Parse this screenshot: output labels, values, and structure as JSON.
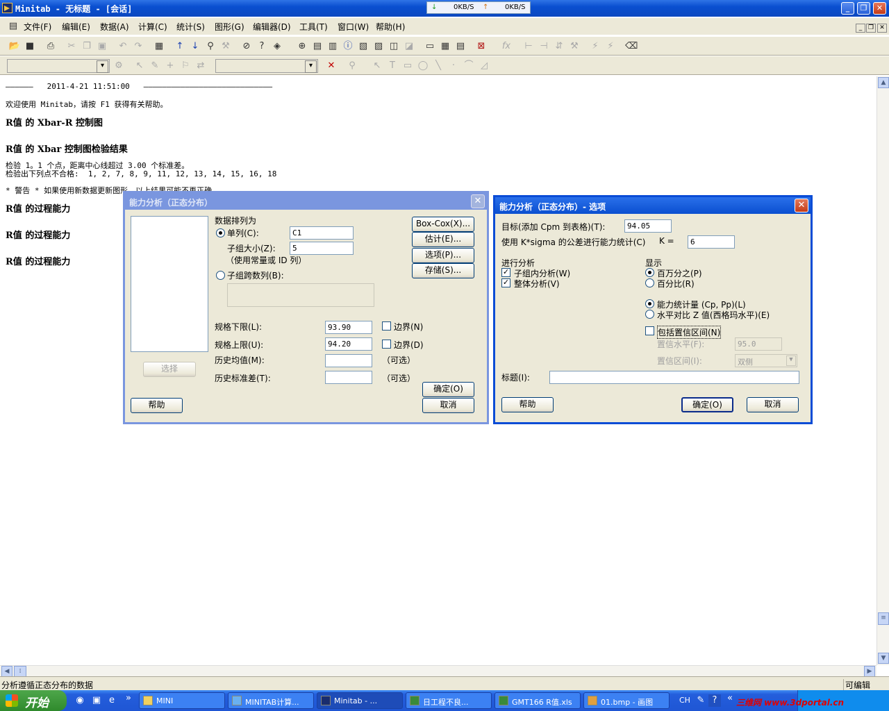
{
  "window": {
    "title": "Minitab - 无标题 - [会话]",
    "net_down": "0KB/S",
    "net_up": "0KB/S"
  },
  "menu": [
    "文件(F)",
    "编辑(E)",
    "数据(A)",
    "计算(C)",
    "统计(S)",
    "图形(G)",
    "编辑器(D)",
    "工具(T)",
    "窗口(W)",
    "帮助(H)"
  ],
  "session": {
    "line1": "——————   2011-4-21 11:51:00   ————————————————————————————",
    "line2": "欢迎使用 Minitab，请按 F1 获得有关帮助。",
    "h1": "R值 的 Xbar-R 控制图",
    "h2": "R值 的 Xbar 控制图检验结果",
    "line3": "检验 1。1 个点，距离中心线超过 3.00 个标准差。",
    "line4": "检验出下列点不合格:  1, 2, 7, 8, 9, 11, 12, 13, 14, 15, 16, 18",
    "line5": "* 警告 * 如果使用新数据更新图形，以上结果可能不再正确。",
    "h3": "R值 的过程能力",
    "h4": "R值 的过程能力",
    "h5": "R值 的过程能力"
  },
  "dialog1": {
    "title": "能力分析（正态分布）",
    "arrange_label": "数据排列为",
    "single_col": "单列(C):",
    "single_val": "C1",
    "subgroup_size": "子组大小(Z):",
    "subgroup_val": "5",
    "hint": "（使用常量或 ID 列）",
    "across_cols": "子组跨数列(B):",
    "select": "选择",
    "lsl": "规格下限(L):",
    "lsl_val": "93.90",
    "usl": "规格上限(U):",
    "usl_val": "94.20",
    "bound": "边界(N)",
    "bound2": "边界(D)",
    "hist_mean": "历史均值(M):",
    "optional": "（可选）",
    "hist_sd": "历史标准差(T):",
    "optional2": "（可选）",
    "boxcox": "Box-Cox(X)...",
    "estimate": "估计(E)...",
    "options": "选项(P)...",
    "storage": "存储(S)...",
    "ok": "确定(O)",
    "cancel": "取消",
    "help": "帮助"
  },
  "dialog2": {
    "title": "能力分析（正态分布）- 选项",
    "target": "目标(添加 Cpm 到表格)(T):",
    "target_val": "94.05",
    "ksigma": "使用 K*sigma 的公差进行能力统计(C)",
    "k_label": "K =",
    "k_val": "6",
    "perform": "进行分析",
    "within": "子组内分析(W)",
    "overall": "整体分析(V)",
    "display": "显示",
    "ppm": "百万分之(P)",
    "percent": "百分比(R)",
    "stats": "能力统计量 (Cp, Pp)(L)",
    "zbench": "水平对比 Z 值(西格玛水平)(E)",
    "ci": "包括置信区间(N)",
    "conf_level": "置信水平(F):",
    "conf_val": "95.0",
    "conf_int": "置信区间(I):",
    "conf_int_val": "双侧",
    "title_label": "标题(I):",
    "help": "帮助",
    "ok": "确定(O)",
    "cancel": "取消"
  },
  "status": {
    "left": "分析遵循正态分布的数据",
    "right": "可编辑"
  },
  "taskbar": {
    "start": "开始",
    "tasks": [
      "MINI",
      "MINITAB计算...",
      "Minitab - ...",
      "日工程不良...",
      "GMT166 R值.xls",
      "01.bmp - 画图"
    ],
    "lang": "CH",
    "watermark": "三维网 www.3dportal.cn"
  }
}
